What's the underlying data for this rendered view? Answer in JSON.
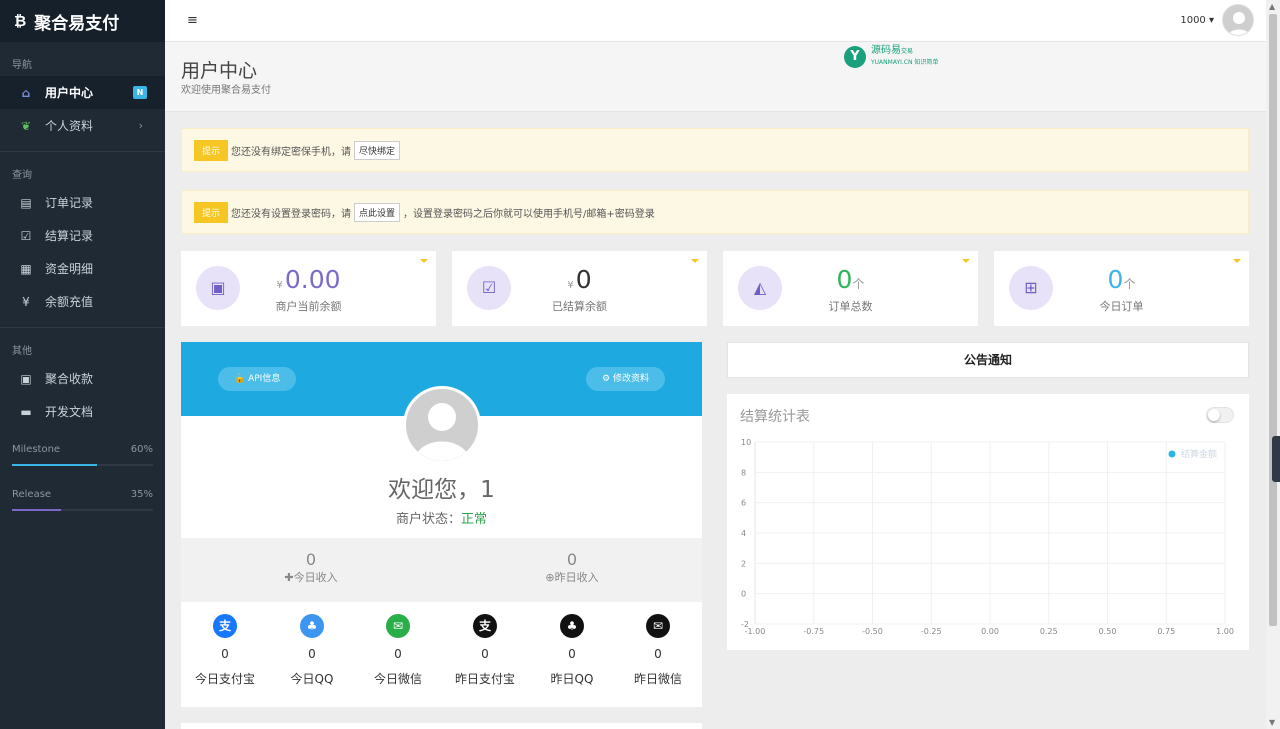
{
  "app": {
    "brand": "聚合易支付",
    "brand_icon": "bitcoin-icon"
  },
  "sidebar": {
    "sections": [
      {
        "label": "导航",
        "items": [
          {
            "label": "用户中心",
            "icon": "home-icon",
            "badge": "N",
            "active": true
          },
          {
            "label": "个人资料",
            "icon": "leaf-icon",
            "chevron": "›"
          }
        ]
      },
      {
        "label": "查询",
        "items": [
          {
            "label": "订单记录",
            "icon": "list-icon"
          },
          {
            "label": "结算记录",
            "icon": "check-square-icon"
          },
          {
            "label": "资金明细",
            "icon": "calendar-icon"
          },
          {
            "label": "余额充值",
            "icon": "yen-icon"
          }
        ]
      },
      {
        "label": "其他",
        "items": [
          {
            "label": "聚合收款",
            "icon": "qrcode-icon"
          },
          {
            "label": "开发文档",
            "icon": "book-icon"
          }
        ]
      }
    ],
    "progress": [
      {
        "label": "Milestone",
        "value": "60%",
        "fraction": 0.6,
        "color": "#3bb4e8"
      },
      {
        "label": "Release",
        "value": "35%",
        "fraction": 0.35,
        "color": "#7b68c8"
      }
    ]
  },
  "topbar": {
    "menu_icon": "≡",
    "username": "1000 ▾"
  },
  "header": {
    "title": "用户中心",
    "subtitle": "欢迎使用聚合易支付",
    "logo_text": "源码易",
    "logo_tag": "交易",
    "logo_sub": "YUANMAYI.CN 知识简单"
  },
  "alerts": [
    {
      "tag": "提示",
      "text": "您还没有绑定密保手机，请",
      "button": "尽快绑定",
      "after": ""
    },
    {
      "tag": "提示",
      "text": "您还没有设置登录密码，请",
      "button": "点此设置",
      "after": "，设置登录密码之后你就可以使用手机号/邮箱+密码登录"
    }
  ],
  "stats": [
    {
      "prefix": "¥",
      "value": "0.00",
      "unit": "",
      "label": "商户当前余额",
      "icon": "money-icon"
    },
    {
      "prefix": "¥",
      "value": "0",
      "unit": "",
      "label": "已结算余额",
      "icon": "check-square-icon"
    },
    {
      "prefix": "",
      "value": "0",
      "unit": "个",
      "label": "订单总数",
      "icon": "area-chart-icon"
    },
    {
      "prefix": "",
      "value": "0",
      "unit": "个",
      "label": "今日订单",
      "icon": "cart-plus-icon"
    }
  ],
  "profile": {
    "api_button": "API信息",
    "edit_button": "修改资料",
    "welcome": "欢迎您，1",
    "status_label": "商户状态：",
    "status_value": "正常",
    "today_income_value": "0",
    "today_income_label": "今日收入",
    "yesterday_income_value": "0",
    "yesterday_income_label": "昨日收入",
    "payments": [
      {
        "value": "0",
        "label": "今日支付宝",
        "icon": "alipay-icon",
        "color": "#1677ff",
        "glyph": "支"
      },
      {
        "value": "0",
        "label": "今日QQ",
        "icon": "qq-icon",
        "color": "#3c96f0",
        "glyph": "♣"
      },
      {
        "value": "0",
        "label": "今日微信",
        "icon": "wechat-icon",
        "color": "#2aae4a",
        "glyph": "✉"
      },
      {
        "value": "0",
        "label": "昨日支付宝",
        "icon": "alipay-icon",
        "color": "#111111",
        "glyph": "支"
      },
      {
        "value": "0",
        "label": "昨日QQ",
        "icon": "qq-icon",
        "color": "#111111",
        "glyph": "♣"
      },
      {
        "value": "0",
        "label": "昨日微信",
        "icon": "wechat-icon",
        "color": "#111111",
        "glyph": "✉"
      }
    ]
  },
  "notice": {
    "title": "公告通知"
  },
  "chart_data": {
    "type": "line",
    "title": "结算统计表",
    "legend": [
      "结算金额"
    ],
    "legend_position": "top-right",
    "xlim": [
      -1.0,
      1.0
    ],
    "ylim": [
      -2,
      10
    ],
    "xticks": [
      "-1.00",
      "-0.75",
      "-0.50",
      "-0.25",
      "0.00",
      "0.25",
      "0.50",
      "0.75",
      "1.00"
    ],
    "yticks": [
      "10",
      "8",
      "6",
      "4",
      "2",
      "0",
      "-2"
    ],
    "series": [
      {
        "name": "结算金额",
        "values": [],
        "color": "#2bb4e8"
      }
    ],
    "grid": true
  }
}
